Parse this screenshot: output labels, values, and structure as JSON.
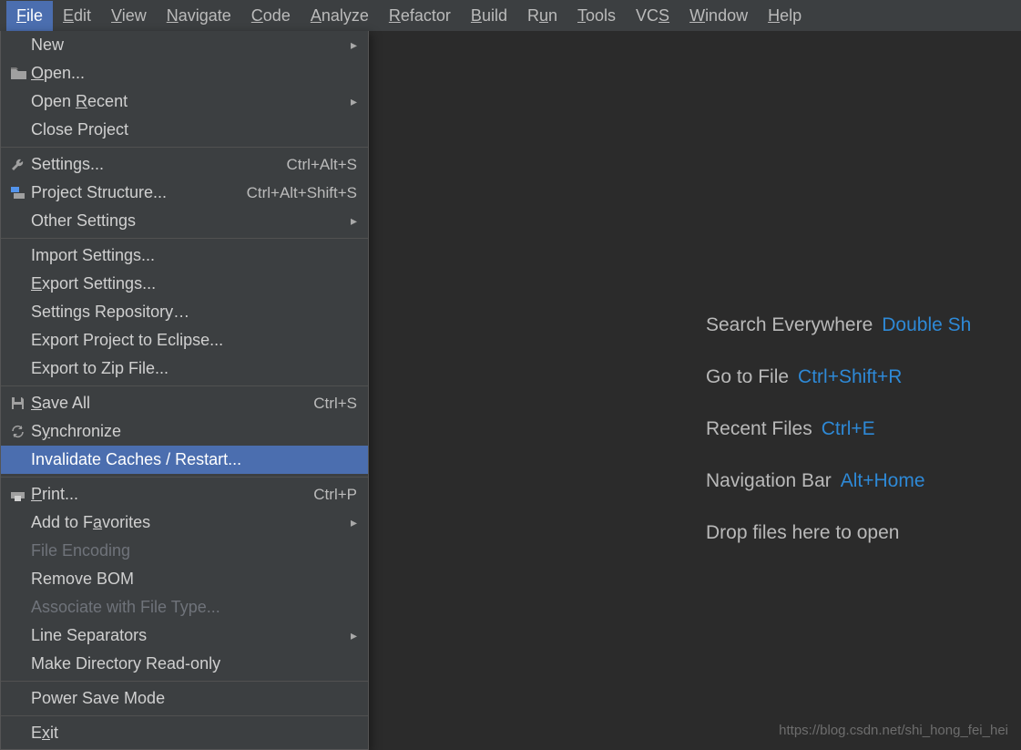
{
  "menubar": [
    {
      "label": "File",
      "mn": "F",
      "active": true
    },
    {
      "label": "Edit",
      "mn": "E"
    },
    {
      "label": "View",
      "mn": "V"
    },
    {
      "label": "Navigate",
      "mn": "N"
    },
    {
      "label": "Code",
      "mn": "C"
    },
    {
      "label": "Analyze",
      "mn": "A"
    },
    {
      "label": "Refactor",
      "mn": "R"
    },
    {
      "label": "Build",
      "mn": "B"
    },
    {
      "label": "Run",
      "mn": "u"
    },
    {
      "label": "Tools",
      "mn": "T"
    },
    {
      "label": "VCS",
      "mn": "S"
    },
    {
      "label": "Window",
      "mn": "W"
    },
    {
      "label": "Help",
      "mn": "H"
    }
  ],
  "dropdown": [
    {
      "label": "New",
      "submenu": true
    },
    {
      "label": "Open...",
      "mn": "O",
      "icon": "folder"
    },
    {
      "label": "Open Recent",
      "mn": "R",
      "submenu": true
    },
    {
      "label": "Close Project"
    },
    {
      "sep": true
    },
    {
      "label": "Settings...",
      "icon": "wrench",
      "shortcut": "Ctrl+Alt+S"
    },
    {
      "label": "Project Structure...",
      "icon": "structure",
      "shortcut": "Ctrl+Alt+Shift+S"
    },
    {
      "label": "Other Settings",
      "submenu": true
    },
    {
      "sep": true
    },
    {
      "label": "Import Settings..."
    },
    {
      "label": "Export Settings...",
      "mn": "E"
    },
    {
      "label": "Settings Repository…"
    },
    {
      "label": "Export Project to Eclipse..."
    },
    {
      "label": "Export to Zip File..."
    },
    {
      "sep": true
    },
    {
      "label": "Save All",
      "mn": "S",
      "icon": "save",
      "shortcut": "Ctrl+S"
    },
    {
      "label": "Synchronize",
      "mn": "y",
      "icon": "sync"
    },
    {
      "label": "Invalidate Caches / Restart...",
      "selected": true
    },
    {
      "sep": true
    },
    {
      "label": "Print...",
      "mn": "P",
      "icon": "print",
      "shortcut": "Ctrl+P"
    },
    {
      "label": "Add to Favorites",
      "mn": "a",
      "submenu": true
    },
    {
      "label": "File Encoding",
      "disabled": true
    },
    {
      "label": "Remove BOM"
    },
    {
      "label": "Associate with File Type...",
      "disabled": true
    },
    {
      "label": "Line Separators",
      "submenu": true
    },
    {
      "label": "Make Directory Read-only"
    },
    {
      "sep": true
    },
    {
      "label": "Power Save Mode"
    },
    {
      "sep": true
    },
    {
      "label": "Exit",
      "mn": "x"
    }
  ],
  "welcome": [
    {
      "text": "Search Everywhere",
      "key": "Double Sh"
    },
    {
      "text": "Go to File",
      "key": "Ctrl+Shift+R"
    },
    {
      "text": "Recent Files",
      "key": "Ctrl+E"
    },
    {
      "text": "Navigation Bar",
      "key": "Alt+Home"
    },
    {
      "text": "Drop files here to open"
    }
  ],
  "watermark": "https://blog.csdn.net/shi_hong_fei_hei"
}
